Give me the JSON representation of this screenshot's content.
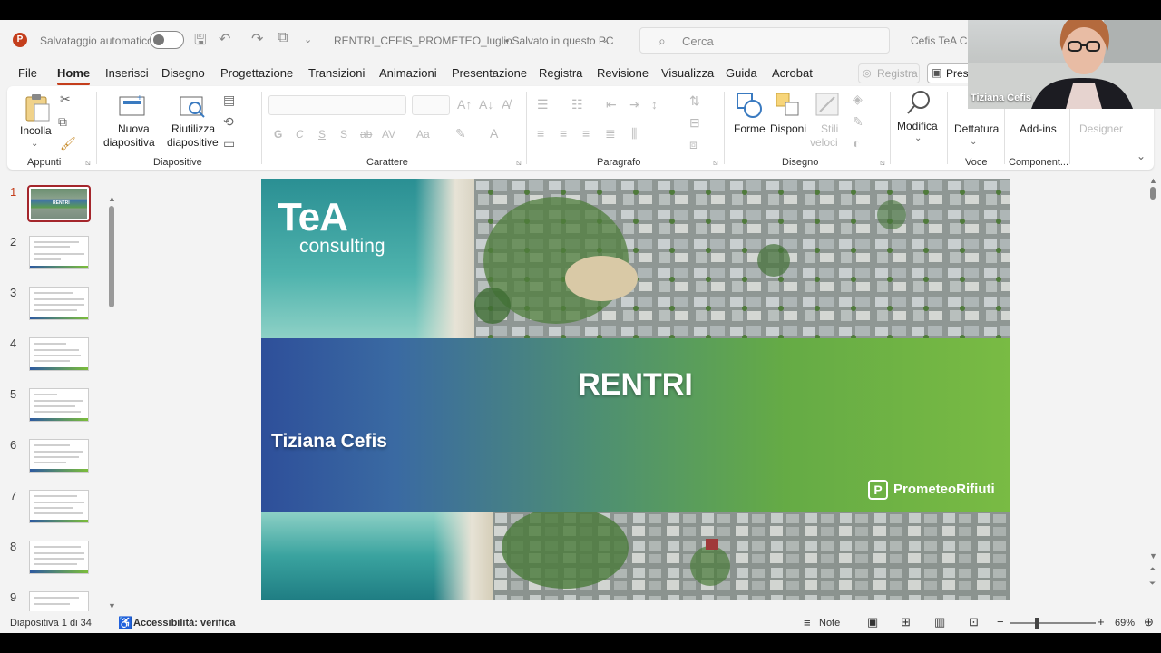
{
  "titlebar": {
    "app_icon": "P",
    "autosave_label": "Salvataggio automatico",
    "filename": "RENTRI_CEFIS_PROMETEO_luglio...",
    "save_status": "• Salvato in questo PC",
    "search_placeholder": "Cerca",
    "user_name": "Cefis TeA Cor"
  },
  "menu": {
    "tabs": [
      "File",
      "Home",
      "Inserisci",
      "Disegno",
      "Progettazione",
      "Transizioni",
      "Animazioni",
      "Presentazione",
      "Registra",
      "Revisione",
      "Visualizza",
      "Guida",
      "Acrobat"
    ],
    "active_tab": "Home",
    "registra_button": "Registra",
    "present_button": "Pres"
  },
  "ribbon": {
    "groups": {
      "appunti": "Appunti",
      "diapositive": "Diapositive",
      "carattere": "Carattere",
      "paragrafo": "Paragrafo",
      "disegno": "Disegno",
      "voce": "Voce",
      "componenti": "Component..."
    },
    "buttons": {
      "incolla": "Incolla",
      "nuova_1": "Nuova",
      "nuova_2": "diapositiva",
      "riutilizza_1": "Riutilizza",
      "riutilizza_2": "diapositive",
      "forme": "Forme",
      "disponi": "Disponi",
      "stili_1": "Stili",
      "stili_2": "veloci",
      "modifica": "Modifica",
      "dettatura": "Dettatura",
      "addins": "Add-ins",
      "designer": "Designer"
    },
    "font_buttons": [
      "G",
      "C",
      "S",
      "S",
      "ab",
      "AV",
      "Aa"
    ]
  },
  "thumbnails": {
    "numbers": [
      "1",
      "2",
      "3",
      "4",
      "5",
      "6",
      "7",
      "8",
      "9"
    ],
    "active_label": "RENTRI"
  },
  "slide": {
    "title": "RENTRI",
    "author": "Tiziana Cefis",
    "logo_big": "TeA",
    "logo_small": "consulting",
    "brand_icon": "P",
    "brand": "PrometeoRifiuti"
  },
  "webcam": {
    "participant": "Tiziana Cefis"
  },
  "status": {
    "slide_counter": "Diapositiva 1 di 34",
    "accessibility": "Accessibilità: verifica",
    "notes": "Note",
    "zoom": "69%"
  },
  "colors": {
    "accent": "#c43e1c",
    "band_start": "#2e4f9a",
    "band_end": "#79bb44"
  }
}
